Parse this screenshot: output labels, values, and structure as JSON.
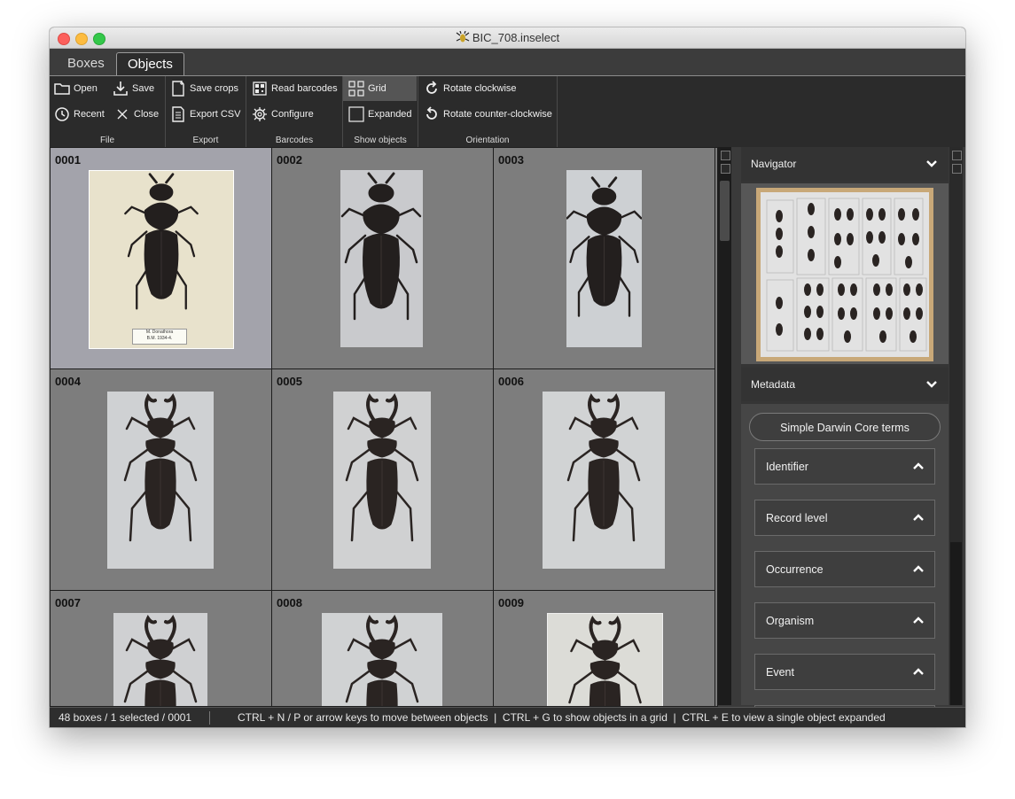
{
  "window": {
    "title": "BIC_708.inselect"
  },
  "tabs": [
    {
      "label": "Boxes",
      "active": false
    },
    {
      "label": "Objects",
      "active": true
    }
  ],
  "ribbon": {
    "file": {
      "group_label": "File",
      "open": "Open",
      "save": "Save",
      "recent": "Recent",
      "close": "Close"
    },
    "export": {
      "group_label": "Export",
      "save_crops": "Save crops",
      "export_csv": "Export CSV"
    },
    "barcodes": {
      "group_label": "Barcodes",
      "read_barcodes": "Read barcodes",
      "configure": "Configure"
    },
    "show_objects": {
      "group_label": "Show objects",
      "grid": "Grid",
      "expanded": "Expanded",
      "selected": "Grid"
    },
    "orientation": {
      "group_label": "Orientation",
      "rotate_cw": "Rotate clockwise",
      "rotate_ccw": "Rotate counter-clockwise"
    }
  },
  "grid": {
    "cells": [
      {
        "label": "0001",
        "selected": true
      },
      {
        "label": "0002",
        "selected": false
      },
      {
        "label": "0003",
        "selected": false
      },
      {
        "label": "0004",
        "selected": false
      },
      {
        "label": "0005",
        "selected": false
      },
      {
        "label": "0006",
        "selected": false
      },
      {
        "label": "0007",
        "selected": false
      },
      {
        "label": "0008",
        "selected": false
      },
      {
        "label": "0009",
        "selected": false
      }
    ],
    "specimen_label_lines": [
      "M. Donathora",
      "B.M. 1934-4."
    ]
  },
  "navigator": {
    "title": "Navigator"
  },
  "metadata": {
    "title": "Metadata",
    "template_button": "Simple Darwin Core terms",
    "sections": [
      "Identifier",
      "Record level",
      "Occurrence",
      "Organism",
      "Event"
    ]
  },
  "status": {
    "summary": "48 boxes / 1 selected / 0001",
    "hint": "CTRL + N / P or arrow keys to move between objects  |  CTRL + G to show objects in a grid  |  CTRL + E to view a single object expanded"
  },
  "colors": {
    "selected_cell": "#a3a3ab",
    "cell": "#7d7d7d",
    "panel": "#464646",
    "beetle": "#2a2422",
    "elytra_red": "#4a2626"
  }
}
